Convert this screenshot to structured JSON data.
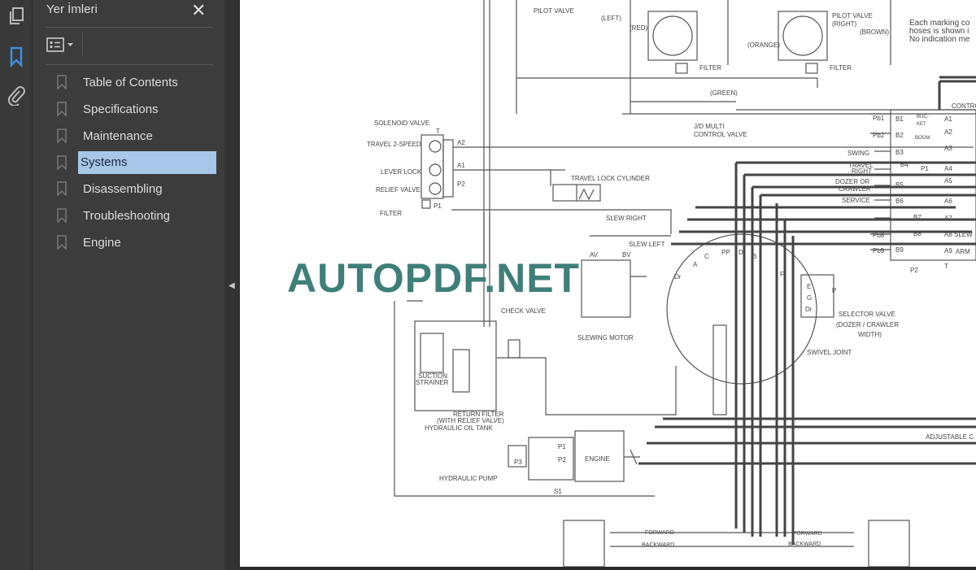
{
  "rail": {
    "icons": [
      "pages-icon",
      "bookmark-icon",
      "attachment-icon"
    ],
    "active": "bookmark-icon",
    "accent": "#3d8fe0"
  },
  "panel": {
    "title": "Yer İmleri",
    "close": "✕",
    "bookmarks": [
      {
        "label": "Table of Contents",
        "selected": false
      },
      {
        "label": "Specifications",
        "selected": false
      },
      {
        "label": "Maintenance",
        "selected": false
      },
      {
        "label": "Systems",
        "selected": true
      },
      {
        "label": "Disassembling",
        "selected": false
      },
      {
        "label": "Troubleshooting",
        "selected": false
      },
      {
        "label": "Engine",
        "selected": false
      }
    ]
  },
  "document": {
    "watermark": "AUTOPDF.NET",
    "labels": {
      "pilot_valve": "PILOT VALVE",
      "left": "(LEFT)",
      "red": "(RED)",
      "pilot_valve_right": "PILOT VALVE",
      "right": "(RIGHT)",
      "brown": "(BROWN)",
      "orange": "(ORANGE)",
      "note1": "Each marking co",
      "note2": "hoses is shown i",
      "note3": "No indication me",
      "filter1": "FILTER",
      "filter2": "FILTER",
      "green": "(GREEN)",
      "jd_multi": "J/D MULTI",
      "control_valve": "CONTROL VALVE",
      "solenoid_valve": "SOLENOID VALVE",
      "travel_2speed": "TRAVEL 2-SPEED",
      "lever_lock": "LEVER LOCK",
      "relief_valve": "RELIEF VALVE",
      "filter3": "FILTER",
      "a2": "A2",
      "a1": "A1",
      "p2": "P2",
      "p1": "P1",
      "t": "T",
      "travel_lock_cylinder": "TRAVEL LOCK CYLINDER",
      "slew_right": "SLEW RIGHT",
      "slew_left": "SLEW LEFT",
      "av": "AV",
      "bv": "BV",
      "slewing_motor": "SLEWING MOTOR",
      "check_valve": "CHECK VALVE",
      "suction": "SUCTION",
      "strainer": "STRAINER",
      "return_filter": "RETURN FILTER",
      "with_relief": "(WITH RELIEF VALVE)",
      "oil_tank": "HYDRAULIC OIL TANK",
      "hydraulic_pump": "HYDRAULIC PUMP",
      "p3": "P3",
      "pump_p1": "P1",
      "pump_p2": "P2",
      "s1": "S1",
      "engine": "ENGINE",
      "swivel_joint": "SWIVEL JOINT",
      "selector_valve": "SELECTOR VALVE",
      "dozer_crawler": "(DOZER / CRAWLER",
      "width": "WIDTH)",
      "swing": "SWING",
      "travel": "TRAVEL",
      "right_lbl": "RIGHT",
      "dozer_or": "DOZER OR",
      "crawler": "CRAWLER",
      "service": "SERVICE",
      "contr": "CONTRO",
      "bucket": "BUC-KET",
      "boom": "BOOM",
      "slew": "SLEW",
      "arm": "ARM",
      "adjustable": "ADJUSTABLE C",
      "forward1": "FORWARD",
      "backward1": "BACKWARD",
      "forward2": "FORWARD",
      "backward2": "BACKWARD",
      "pb1": "Pb1",
      "pb2": "Pb2",
      "pb8": "Pb8",
      "pb9": "Pb9",
      "b_ports": [
        "B1",
        "B2",
        "B3",
        "B4",
        "B5",
        "B6",
        "B7",
        "B8",
        "B9"
      ],
      "a_ports": [
        "A1",
        "A2",
        "A3",
        "A4",
        "A5",
        "A6",
        "A7",
        "A8",
        "A9"
      ],
      "cv_p2": "P2",
      "cv_t": "T",
      "cv_p1": "P1",
      "swivel_ports": [
        "A",
        "C",
        "PP",
        "D",
        "B",
        "Dr",
        "F"
      ],
      "sel_ports": [
        "E",
        "G",
        "Dr",
        "P"
      ]
    }
  }
}
